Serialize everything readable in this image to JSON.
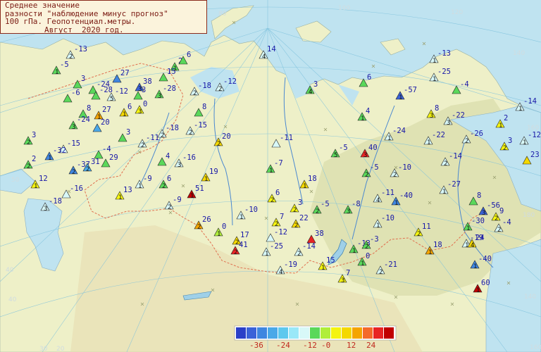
{
  "title": {
    "line1": "Среднее значение",
    "line2": "разности \"наблюдение минус прогноз\"",
    "line3": "100 гПа. Геопотенциал.метры.",
    "line4": "Август  2020 год."
  },
  "legend": {
    "colors": [
      "#2a3fc8",
      "#3a62d8",
      "#3f86e0",
      "#4aa8e8",
      "#5ec8ee",
      "#9ae8f8",
      "#d8f8f8",
      "#5ad85a",
      "#b0ee3a",
      "#f4f410",
      "#f4d800",
      "#f4a400",
      "#f46a2a",
      "#e82424",
      "#c00000"
    ],
    "labels": [
      "-36",
      "-24",
      "-12",
      "-0",
      "12",
      "24"
    ]
  },
  "stations": [
    {
      "v": "-13",
      "n": "2",
      "c": "#d8f8f8"
    },
    {
      "v": "-5",
      "n": "1",
      "c": "#5ad85a"
    },
    {
      "v": "2",
      "n": "1",
      "c": "#5ad85a"
    },
    {
      "v": "6",
      "n": "",
      "c": "#5ad85a"
    },
    {
      "v": "14",
      "n": "4",
      "c": "#d8f8f8"
    },
    {
      "v": "3",
      "n": "",
      "c": "#5ad85a"
    },
    {
      "v": "27",
      "n": "",
      "c": "#3f86e0"
    },
    {
      "v": "15",
      "n": "",
      "c": "#5ad85a"
    },
    {
      "v": "-6",
      "n": "",
      "c": "#5ad85a"
    },
    {
      "v": "-24",
      "n": "",
      "c": "#5ad85a"
    },
    {
      "v": "-28",
      "n": "",
      "c": "#5ad85a"
    },
    {
      "v": "-12",
      "n": "5",
      "c": "#d8f8f8"
    },
    {
      "v": "38",
      "n": "3",
      "c": "#3a62d8"
    },
    {
      "v": "3",
      "n": "",
      "c": "#5ad85a"
    },
    {
      "v": "-28",
      "n": "3",
      "c": "#5ad85a"
    },
    {
      "v": "-18",
      "n": "2",
      "c": "#d8f8f8"
    },
    {
      "v": "-12",
      "n": "2",
      "c": "#d8f8f8"
    },
    {
      "v": "6",
      "n": "",
      "c": "#5ad85a"
    },
    {
      "v": "3",
      "n": "4",
      "c": "#5ad85a"
    },
    {
      "v": "-57",
      "n": "1",
      "c": "#3a62d8"
    },
    {
      "v": "-4",
      "n": "",
      "c": "#5ad85a"
    },
    {
      "v": "-13",
      "n": "1",
      "c": "#d8f8f8"
    },
    {
      "v": "-25",
      "n": "1",
      "c": "#d8f8f8"
    },
    {
      "v": "-14",
      "n": "1",
      "c": "#d8f8f8"
    },
    {
      "v": "8",
      "n": "",
      "c": "#5ad85a"
    },
    {
      "v": "27",
      "n": "1",
      "c": "#f4a400"
    },
    {
      "v": "6",
      "n": "1",
      "c": "#f4d800"
    },
    {
      "v": "0",
      "n": "3",
      "c": "#f4f410"
    },
    {
      "v": "-24",
      "n": "3",
      "c": "#5ad85a"
    },
    {
      "v": "8",
      "n": "",
      "c": "#5ad85a"
    },
    {
      "v": "20",
      "n": "",
      "c": "#4aa8e8"
    },
    {
      "v": "-18",
      "n": "2",
      "c": "#d8f8f8"
    },
    {
      "v": "-15",
      "n": "2",
      "c": "#d8f8f8"
    },
    {
      "v": "20",
      "n": "2",
      "c": "#f4d800"
    },
    {
      "v": "4",
      "n": "1",
      "c": "#5ad85a"
    },
    {
      "v": "8",
      "n": "3",
      "c": "#f4f410"
    },
    {
      "v": "-22",
      "n": "3",
      "c": "#d8f8f8"
    },
    {
      "v": "2",
      "n": "1",
      "c": "#f4f410"
    },
    {
      "v": "-12",
      "n": "1",
      "c": "#d8f8f8"
    },
    {
      "v": "3",
      "n": "2",
      "c": "#5ad85a"
    },
    {
      "v": "-15",
      "n": "",
      "c": "#d8f8f8"
    },
    {
      "v": "3",
      "n": "",
      "c": "#5ad85a"
    },
    {
      "v": "-11",
      "n": "2",
      "c": "#d8f8f8"
    },
    {
      "v": "-11",
      "n": "",
      "c": "#d8f8f8"
    },
    {
      "v": "-24",
      "n": "1",
      "c": "#d8f8f8"
    },
    {
      "v": "-22",
      "n": "1",
      "c": "#d8f8f8"
    },
    {
      "v": "-26",
      "n": "2",
      "c": "#d8f8f8"
    },
    {
      "v": "3",
      "n": "2",
      "c": "#f4f410"
    },
    {
      "v": "23",
      "n": "",
      "c": "#f4d800"
    },
    {
      "v": "-32",
      "n": "1",
      "c": "#3f86e0"
    },
    {
      "v": "-4",
      "n": "",
      "c": "#5ad85a"
    },
    {
      "v": "29",
      "n": "",
      "c": "#5ad85a"
    },
    {
      "v": "-16",
      "n": "3",
      "c": "#d8f8f8"
    },
    {
      "v": "-7",
      "n": "1",
      "c": "#5ad85a"
    },
    {
      "v": "-5",
      "n": "5",
      "c": "#5ad85a"
    },
    {
      "v": "40",
      "n": "3",
      "c": "#e82424"
    },
    {
      "v": "-14",
      "n": "2",
      "c": "#d8f8f8"
    },
    {
      "v": "2",
      "n": "2",
      "c": "#5ad85a"
    },
    {
      "v": "-37",
      "n": "2",
      "c": "#3f86e0"
    },
    {
      "v": "31",
      "n": "2",
      "c": "#4aa8e8"
    },
    {
      "v": "4",
      "n": "",
      "c": "#5ad85a"
    },
    {
      "v": "-5",
      "n": "2",
      "c": "#5ad85a"
    },
    {
      "v": "-10",
      "n": "2",
      "c": "#d8f8f8"
    },
    {
      "v": "12",
      "n": "1",
      "c": "#f4f410"
    },
    {
      "v": "-9",
      "n": "1",
      "c": "#d8f8f8"
    },
    {
      "v": "6",
      "n": "2",
      "c": "#5ad85a"
    },
    {
      "v": "19",
      "n": "1",
      "c": "#f4d800"
    },
    {
      "v": "18",
      "n": "1",
      "c": "#f4d800"
    },
    {
      "v": "-27",
      "n": "1",
      "c": "#d8f8f8"
    },
    {
      "v": "-16",
      "n": "",
      "c": "#d8f8f8"
    },
    {
      "v": "13",
      "n": "1",
      "c": "#f4f410"
    },
    {
      "v": "51",
      "n": "1",
      "c": "#c00000"
    },
    {
      "v": "6",
      "n": "2",
      "c": "#f4f410"
    },
    {
      "v": "-11",
      "n": "4",
      "c": "#d8f8f8"
    },
    {
      "v": "-40",
      "n": "1",
      "c": "#3f86e0"
    },
    {
      "v": "8",
      "n": "",
      "c": "#5ad85a"
    },
    {
      "v": "-18",
      "n": "3",
      "c": "#d8f8f8"
    },
    {
      "v": "-9",
      "n": "2",
      "c": "#d8f8f8"
    },
    {
      "v": "3",
      "n": "2",
      "c": "#f4f410"
    },
    {
      "v": "-5",
      "n": "2",
      "c": "#5ad85a"
    },
    {
      "v": "-8",
      "n": "3",
      "c": "#5ad85a"
    },
    {
      "v": "-56",
      "n": "3",
      "c": "#3a62d8"
    },
    {
      "v": "9",
      "n": "2",
      "c": "#f4f410"
    },
    {
      "v": "-10",
      "n": "1",
      "c": "#d8f8f8"
    },
    {
      "v": "7",
      "n": "2",
      "c": "#f4f410"
    },
    {
      "v": "22",
      "n": "2",
      "c": "#f4d800"
    },
    {
      "v": "-10",
      "n": "1",
      "c": "#d8f8f8"
    },
    {
      "v": "-30",
      "n": "1",
      "c": "#5ad85a"
    },
    {
      "v": "-4",
      "n": "2",
      "c": "#d8f8f8"
    },
    {
      "v": "26",
      "n": "2",
      "c": "#f4a400"
    },
    {
      "v": "0",
      "n": "1",
      "c": "#b0ee3a"
    },
    {
      "v": "-12",
      "n": "",
      "c": "#d8f8f8"
    },
    {
      "v": "38",
      "n": "",
      "c": "#e82424"
    },
    {
      "v": "11",
      "n": "2",
      "c": "#f4f410"
    },
    {
      "v": "17",
      "n": "2",
      "c": "#f4d800"
    },
    {
      "v": "41",
      "n": "2",
      "c": "#e82424"
    },
    {
      "v": "-25",
      "n": "1",
      "c": "#d8f8f8"
    },
    {
      "v": "-14",
      "n": "2",
      "c": "#d8f8f8"
    },
    {
      "v": "-13",
      "n": "1",
      "c": "#5ad85a"
    },
    {
      "v": "-3",
      "n": "2",
      "c": "#5ad85a"
    },
    {
      "v": "18",
      "n": "1",
      "c": "#f4a400"
    },
    {
      "v": "-19",
      "n": "1",
      "c": "#d8f8f8"
    },
    {
      "v": "24",
      "n": "4",
      "c": "#f4d800"
    },
    {
      "v": "-19",
      "n": "4",
      "c": "#d8f8f8"
    },
    {
      "v": "15",
      "n": "1",
      "c": "#f4f410"
    },
    {
      "v": "0",
      "n": "1",
      "c": "#5ad85a"
    },
    {
      "v": "-21",
      "n": "2",
      "c": "#d8f8f8"
    },
    {
      "v": "-40",
      "n": "1",
      "c": "#3f86e0"
    },
    {
      "v": "7",
      "n": "3",
      "c": "#f4f410"
    },
    {
      "v": "60",
      "n": "1",
      "c": "#c00000"
    }
  ],
  "grid_labels": [
    "80",
    "100",
    "120",
    "140",
    "160",
    "180",
    "40",
    "60",
    "50",
    "40",
    "30",
    "160",
    "140",
    "20",
    "40"
  ]
}
